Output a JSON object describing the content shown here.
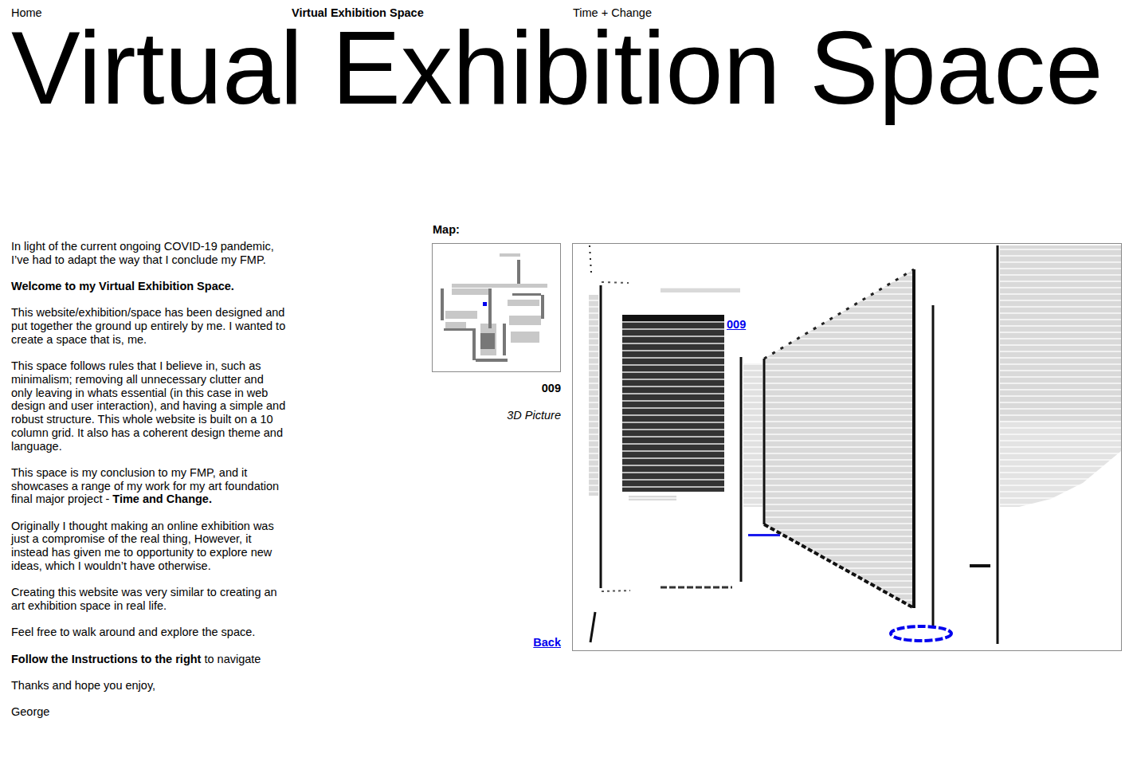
{
  "nav": [
    {
      "label": "Home",
      "selected": false
    },
    {
      "label": "Virtual Exhibition Space",
      "selected": true
    },
    {
      "label": "Time + Change",
      "selected": false
    }
  ],
  "title": "Virtual Exhibition Space",
  "intro": [
    {
      "runs": [
        {
          "text": "In light of the current ongoing COVID-19 pandemic, I’ve had to adapt the way that I conclude my FMP.",
          "bold": false
        }
      ]
    },
    {
      "runs": [
        {
          "text": "Welcome to my Virtual Exhibition Space.",
          "bold": true
        }
      ]
    },
    {
      "runs": [
        {
          "text": "This website/exhibition/space has been designed and put together the ground up entirely by me. I wanted to create a space that is, me.",
          "bold": false
        }
      ]
    },
    {
      "runs": [
        {
          "text": "This space follows rules that I believe in, such as minimalism; removing all unnecessary clutter and only leaving in whats essential (in this case in web design and user interaction), and having a simple and robust structure. This whole website is built on a 10 column grid. It also has a coherent design theme and language.",
          "bold": false
        }
      ]
    },
    {
      "runs": [
        {
          "text": "This space is my conclusion to my FMP, and it showcases a range of my work for my art foundation final major project - ",
          "bold": false
        },
        {
          "text": "Time and Change.",
          "bold": true
        }
      ]
    },
    {
      "runs": [
        {
          "text": "Originally I thought making an online exhibition was just a compromise of the real thing, However, it instead has given me to opportunity to explore new ideas, which I wouldn’t have otherwise.",
          "bold": false
        }
      ]
    },
    {
      "runs": [
        {
          "text": "Creating this website was very similar to creating an art exhibition space in real life.",
          "bold": false
        }
      ]
    },
    {
      "runs": [
        {
          "text": "Feel free to walk around and explore the space.",
          "bold": false
        }
      ]
    },
    {
      "runs": [
        {
          "text": "Follow the Instructions to the right",
          "bold": true
        },
        {
          "text": " to navigate",
          "bold": false
        }
      ]
    },
    {
      "runs": [
        {
          "text": "Thanks and hope you enjoy,",
          "bold": false
        }
      ]
    },
    {
      "runs": [
        {
          "text": "George",
          "bold": false
        }
      ]
    }
  ],
  "map": {
    "label": "Map:"
  },
  "exhibit": {
    "number": "009",
    "caption": "3D Picture"
  },
  "back": "Back",
  "view": {
    "link": "009"
  }
}
